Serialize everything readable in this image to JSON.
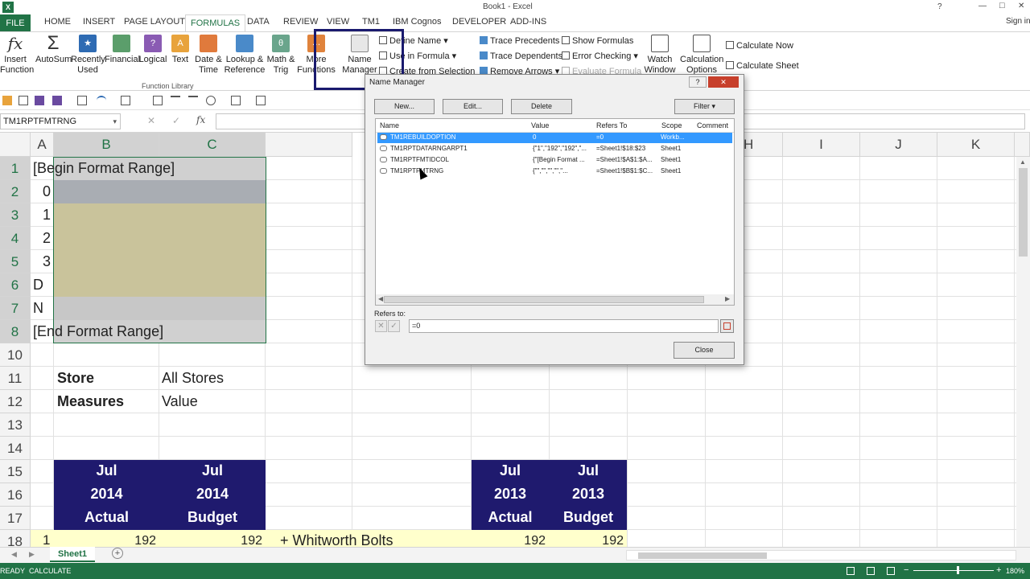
{
  "window": {
    "title": "Book1 - Excel",
    "sign_in": "Sign in",
    "help": "?",
    "minimize": "—",
    "restore": "□",
    "close": "✕"
  },
  "tabs": {
    "file": "FILE",
    "home": "HOME",
    "insert": "INSERT",
    "page_layout": "PAGE LAYOUT",
    "formulas": "FORMULAS",
    "data": "DATA",
    "review": "REVIEW",
    "view": "VIEW",
    "tm1": "TM1",
    "ibm": "IBM Cognos",
    "developer": "DEVELOPER",
    "addins": "ADD-INS"
  },
  "ribbon": {
    "insert_function": "Insert\nFunction",
    "autosum": "AutoSum",
    "recently_used": "Recently\nUsed",
    "financial": "Financial",
    "logical": "Logical",
    "text": "Text",
    "date_time": "Date &\nTime",
    "lookup": "Lookup &\nReference",
    "math": "Math &\nTrig",
    "more_functions": "More\nFunctions",
    "function_library": "Function Library",
    "name_manager": "Name\nManager",
    "define_name": "Define Name",
    "use_in_formula": "Use in Formula",
    "create_from_selection": "Create from Selection",
    "trace_precedents": "Trace Precedents",
    "trace_dependents": "Trace Dependents",
    "remove_arrows": "Remove Arrows",
    "show_formulas": "Show Formulas",
    "error_checking": "Error Checking",
    "evaluate_formula": "Evaluate Formula",
    "watch_window": "Watch\nWindow",
    "calculation_options": "Calculation\nOptions",
    "calculate_now": "Calculate Now",
    "calculate_sheet": "Calculate Sheet"
  },
  "formula_bar": {
    "name_box": "TM1RPTFMTRNG",
    "cancel": "✕",
    "enter": "✓",
    "fx": "fx",
    "value": ""
  },
  "columns": [
    "A",
    "B",
    "C",
    "H",
    "I",
    "J",
    "K"
  ],
  "rows": [
    "1",
    "2",
    "3",
    "4",
    "5",
    "6",
    "7",
    "8",
    "10",
    "11",
    "12",
    "13",
    "14",
    "15",
    "16",
    "17",
    "18"
  ],
  "cells": {
    "a1": "[Begin Format Range]",
    "a2": "0",
    "a3": "1",
    "a4": "2",
    "a5": "3",
    "a6": "D",
    "a7": "N",
    "a8": "[End Format Range]",
    "b11": "Store",
    "c11": "All Stores",
    "b12": "Measures",
    "c12": "Value",
    "b15": "Jul",
    "b16": "2014",
    "b17": "Actual",
    "c15": "Jul",
    "c16": "2014",
    "c17": "Budget",
    "g15": "Jul",
    "g16": "2013",
    "g17": "Actual",
    "h15": "Jul",
    "h16": "2013",
    "h17": "Budget",
    "a18": "1",
    "b18": "192",
    "c18": "192",
    "d18": "+ Whitworth Bolts",
    "g18": "192",
    "h18": "192"
  },
  "dialog": {
    "title": "Name Manager",
    "help": "?",
    "close_x": "✕",
    "new": "New...",
    "edit": "Edit...",
    "delete": "Delete",
    "filter": "Filter",
    "headers": {
      "name": "Name",
      "value": "Value",
      "refers_to": "Refers To",
      "scope": "Scope",
      "comment": "Comment"
    },
    "rows": [
      {
        "name": "TM1REBUILDOPTION",
        "value": "0",
        "refers": "=0",
        "scope": "Workb..."
      },
      {
        "name": "TM1RPTDATARNGARPT1",
        "value": "{\"1\",\"192\",\"192\",\"...",
        "refers": "=Sheet1!$18:$23",
        "scope": "Sheet1"
      },
      {
        "name": "TM1RPTFMTIDCOL",
        "value": "{\"[Begin Format ...",
        "refers": "=Sheet1!$A$1:$A...",
        "scope": "Sheet1"
      },
      {
        "name": "TM1RPTFMTRNG",
        "value": "{\"\",\"\",\"\",\"\",\"...",
        "refers": "=Sheet1!$B$1:$C...",
        "scope": "Sheet1"
      }
    ],
    "refers_to_label": "Refers to:",
    "refers_to_value": "=0",
    "close": "Close"
  },
  "sheet": {
    "tab": "Sheet1",
    "add": "+"
  },
  "status": {
    "ready": "READY",
    "calculate": "CALCULATE",
    "zoom": "180%"
  },
  "colors": {
    "excel_green": "#217346",
    "header_navy": "#1f1a6e",
    "format_tan": "#c9c39b",
    "format_grey": "#a9adb3",
    "row18_yellow": "#ffffcc",
    "selection_blue": "#3399ff"
  }
}
